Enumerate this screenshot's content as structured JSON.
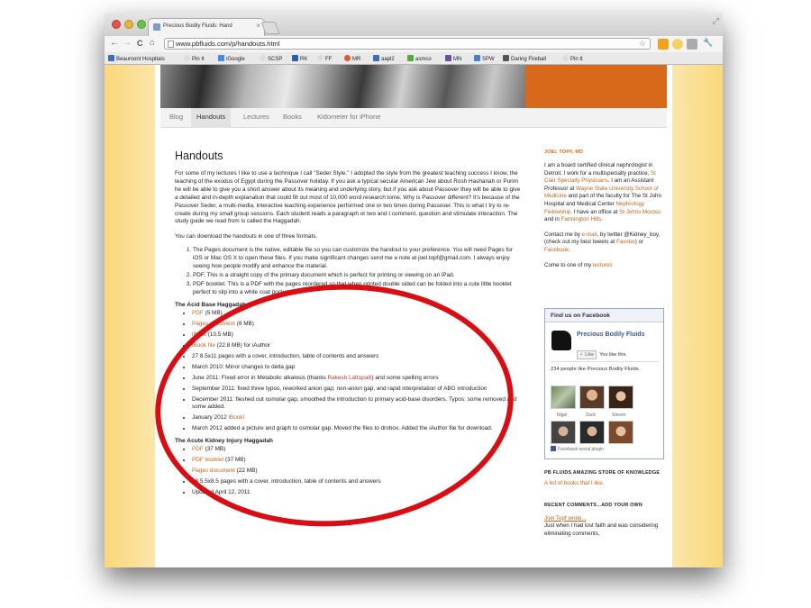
{
  "browser": {
    "tab_title": "Precious Bodily Fluids: Hand",
    "tab_close": "×",
    "url": "www.pbfluids.com/p/handouts.html",
    "back_icon": "←",
    "forward_icon": "→",
    "reload_icon": "C",
    "home_icon": "⌂",
    "star_icon": "☆",
    "wrench_icon": "🔧",
    "bookmarks": [
      "Beaumont Hospitals",
      "Pin It",
      "iGoogle",
      "SCSP",
      "RK",
      "FF",
      "MR",
      "aapl2",
      "asmco",
      "MN",
      "SPW",
      "Daring Fireball",
      "Pin It"
    ]
  },
  "nav": {
    "tabs": [
      "Blog",
      "Handouts",
      "Lectures",
      "Books",
      "Kidometer for iPhone"
    ]
  },
  "main": {
    "title": "Handouts",
    "intro": "For some of my lectures I like to use a technique I call \"Seder Style.\" I adopted the style from the greatest teaching success I know, the teaching of the exodus of Egypt during the Passover holiday. If you ask a typical secular American Jew about Rosh Hashanah or Purim he will be able to give you a short answer about its meaning and underlying story, but if you ask about Passover they will be able to give a detailed and in-depth explanation that could fill out most of 10,000 word research tome. Why is Passover different? It's because of the Passover Seder, a multi-media, interactive teaching experience performed one or two times during Passover. This is what I try to re-create during my small group sessions. Each student reads a paragraph or two and I comment, question and stimulate interaction. The study guide we read from is called the Haggadah.",
    "download_intro": "You can download the handouts in one of three formats.",
    "formats": [
      "The Pages document is the native, editable file so you can customize the handout to your preference. You will need Pages for iOS or Mac OS X to open these files. If you make significant changes send me a note at joel.topf@gmail.com. I always enjoy seeing how people modify and enhance the material.",
      "PDF. This is a straight copy of the primary document which is perfect for printing or viewing on an iPad.",
      "PDF booklet. This is a PDF with the pages reordered so that when printed double sided can be folded into a cute little booklet perfect to slip into a white coat pocket."
    ],
    "acid_base": {
      "heading": "The Acid Base Haggadah",
      "items": [
        {
          "link": "PDF",
          "text": " (5 MB)"
        },
        {
          "link": "Pages document",
          "text": " (8 MB)"
        },
        {
          "link": "iBook",
          "text": " (10.5 MB)"
        },
        {
          "link": "iBook file",
          "text": " (22.8 MB) for iAuthor"
        },
        {
          "link": "",
          "text": "27 8.5x11 pages with a cover, introduction, table of contents and answers"
        },
        {
          "link": "",
          "text": "March 2010: Minor changes to delta gap"
        },
        {
          "pre": "June 2011: Fixed error in Metabolic alkalosis (thanks ",
          "link": "Rakesh Lattupalli",
          "text": ") and some spelling errors"
        },
        {
          "link": "",
          "text": "September 2011: fixed three typos, reworked anion gap, non-anion gap, and rapid interpretation of ABG introduction"
        },
        {
          "link": "",
          "text": "December 2011: fleshed out osmolar gap, smoothed the introduction to primary acid-base disorders. Typos: some removed and some added."
        },
        {
          "pre": "January 2012 ",
          "link": "iBook!",
          "text": ""
        },
        {
          "link": "",
          "text": "March 2012 added a picture and graph to osmolar gap. Moved the files to drobox. Added the iAuthor file for download."
        }
      ]
    },
    "aki": {
      "heading": "The Acute Kidney Injury Haggadah",
      "items": [
        {
          "link": "PDF",
          "text": " (37 MB)"
        },
        {
          "link": "PDF booklet",
          "text": " (37 MB)"
        },
        {
          "link": "Pages document",
          "text": " (22 MB)"
        },
        {
          "link": "",
          "text": "28 5.5x8.5 pages with a cover, introduction, table of contents and answers"
        },
        {
          "link": "",
          "text": "Updated April 12, 2011"
        }
      ]
    }
  },
  "sidebar": {
    "author_heading": "JOEL TOPF, MD",
    "bio": {
      "p1": "I am a board certified clinical nephrologist in Detroit. I work for a multispecialty practice, ",
      "l1": "St Clair Specialty Physicians",
      "p2": ". I am an Assistant Professor at ",
      "l2": "Wayne State University School of Medicine",
      "p3": " and part of the faculty for The St John Hospital and Medical Center ",
      "l3": "Nephrology Fellowship",
      "p4": ". I have an office at ",
      "l4": "St Johns Moross",
      "p5": " and in ",
      "l5": "Farmington Hills",
      "p6": "."
    },
    "contact": {
      "p1": "Contact me by ",
      "l1": "e-mail",
      "p2": ", by twitter @Kidney_boy, (check out my best tweets at ",
      "l2": "Favstar",
      "p3": ") or ",
      "l3": "Facebook",
      "p4": "."
    },
    "lectures": {
      "p1": "Come to one of my ",
      "l1": "lectures"
    },
    "facebook": {
      "heading": "Find us on Facebook",
      "page_name": "Precious Bodily Fluids",
      "like_button": "✓ Like",
      "like_text": "You like this.",
      "count_text": "234 people like Precious Bodily Fluids.",
      "faces": [
        "Nigel",
        "Zack",
        "Steven"
      ],
      "plugin": "Facebook social plugin"
    },
    "store_heading": "PB FLUIDS AMAZING STORE OF KNOWLEDGE",
    "store_link": "A list of books that I like.",
    "comments_heading": "RECENT COMMENTS...ADD YOUR OWN",
    "comment_author": "Joel Topf wrote...",
    "comment_text": "Just when I had lost faith and was considering eliminating comments,"
  },
  "colors": {
    "accent_orange": "#d8681a",
    "link": "#c0651c",
    "annotation_red": "#d90e14",
    "fb_blue": "#3b5998"
  }
}
